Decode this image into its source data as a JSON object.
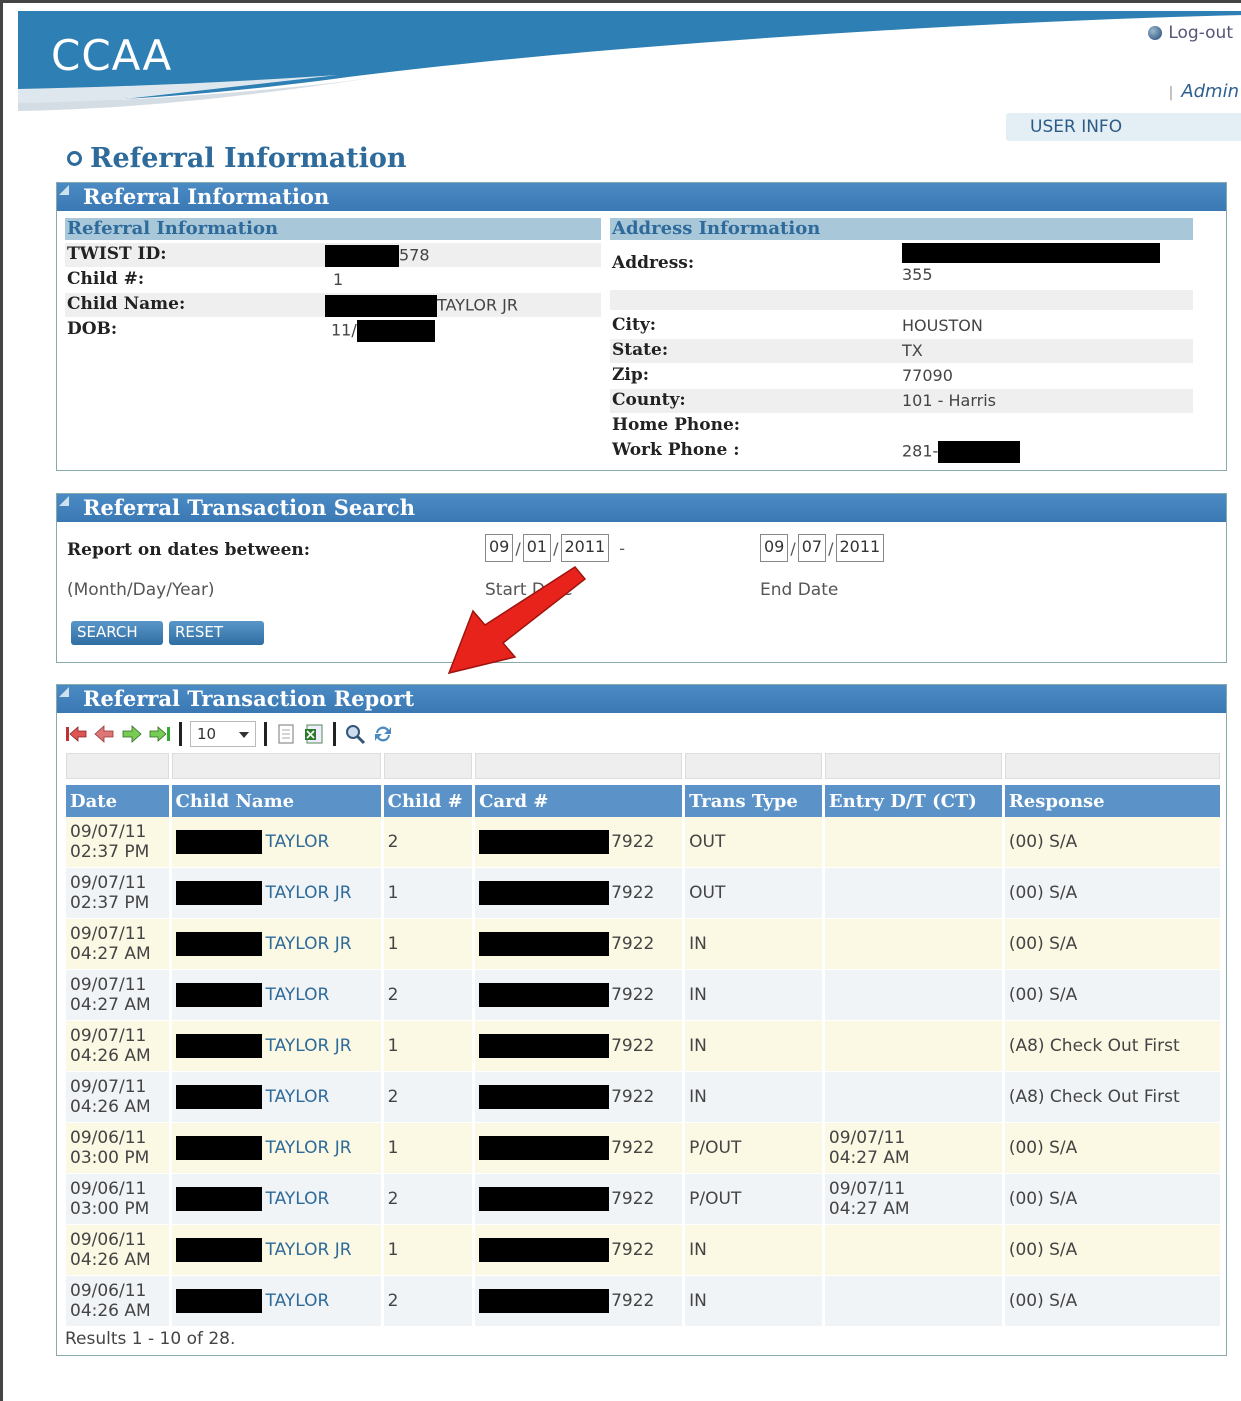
{
  "header": {
    "logo": "CCAA",
    "logout_label": "Log-out",
    "separator": "|",
    "user_name": "Admin",
    "user_info_tab": "USER INFO"
  },
  "page_title": "Referral Information",
  "referral_panel": {
    "title": "Referral Information",
    "left_section": {
      "heading": "Referral Information",
      "rows": [
        {
          "label": "TWIST ID:",
          "value": "578"
        },
        {
          "label": "Child #:",
          "value": "1"
        },
        {
          "label": "Child Name:",
          "value": "TAYLOR JR"
        },
        {
          "label": "DOB:",
          "value": "11/"
        }
      ]
    },
    "right_section": {
      "heading": "Address Information",
      "address_label": "Address:",
      "address_value": "355",
      "rows": [
        {
          "label": "City:",
          "value": "HOUSTON"
        },
        {
          "label": "State:",
          "value": "TX"
        },
        {
          "label": "Zip:",
          "value": "77090"
        },
        {
          "label": "County:",
          "value": "101 - Harris"
        },
        {
          "label": "Home Phone:",
          "value": ""
        },
        {
          "label": "Work Phone :",
          "value": "281-"
        }
      ]
    }
  },
  "search_panel": {
    "title": "Referral Transaction Search",
    "report_label": "Report on dates between:",
    "format_hint": "(Month/Day/Year)",
    "start": {
      "month": "09",
      "day": "01",
      "year": "2011",
      "caption": "Start Date"
    },
    "end": {
      "month": "09",
      "day": "07",
      "year": "2011",
      "caption": "End Date"
    },
    "dash": "-",
    "search_button": "SEARCH",
    "reset_button": "RESET"
  },
  "report_panel": {
    "title": "Referral Transaction Report",
    "page_size": "10",
    "columns": [
      "Date",
      "Child Name",
      "Child #",
      "Card #",
      "Trans Type",
      "Entry D/T (CT)",
      "Response"
    ],
    "rows": [
      {
        "date": "09/07/11",
        "time": "02:37 PM",
        "name": "TAYLOR",
        "child": "2",
        "card": "7922",
        "type": "OUT",
        "entry_date": "",
        "entry_time": "",
        "response": "(00) S/A"
      },
      {
        "date": "09/07/11",
        "time": "02:37 PM",
        "name": "TAYLOR JR",
        "child": "1",
        "card": "7922",
        "type": "OUT",
        "entry_date": "",
        "entry_time": "",
        "response": "(00) S/A"
      },
      {
        "date": "09/07/11",
        "time": "04:27 AM",
        "name": "TAYLOR JR",
        "child": "1",
        "card": "7922",
        "type": "IN",
        "entry_date": "",
        "entry_time": "",
        "response": "(00) S/A"
      },
      {
        "date": "09/07/11",
        "time": "04:27 AM",
        "name": "TAYLOR",
        "child": "2",
        "card": "7922",
        "type": "IN",
        "entry_date": "",
        "entry_time": "",
        "response": "(00) S/A"
      },
      {
        "date": "09/07/11",
        "time": "04:26 AM",
        "name": "TAYLOR JR",
        "child": "1",
        "card": "7922",
        "type": "IN",
        "entry_date": "",
        "entry_time": "",
        "response": "(A8) Check Out First"
      },
      {
        "date": "09/07/11",
        "time": "04:26 AM",
        "name": "TAYLOR",
        "child": "2",
        "card": "7922",
        "type": "IN",
        "entry_date": "",
        "entry_time": "",
        "response": "(A8) Check Out First"
      },
      {
        "date": "09/06/11",
        "time": "03:00 PM",
        "name": "TAYLOR JR",
        "child": "1",
        "card": "7922",
        "type": "P/OUT",
        "entry_date": "09/07/11",
        "entry_time": "04:27 AM",
        "response": "(00) S/A"
      },
      {
        "date": "09/06/11",
        "time": "03:00 PM",
        "name": "TAYLOR",
        "child": "2",
        "card": "7922",
        "type": "P/OUT",
        "entry_date": "09/07/11",
        "entry_time": "04:27 AM",
        "response": "(00) S/A"
      },
      {
        "date": "09/06/11",
        "time": "04:26 AM",
        "name": "TAYLOR JR",
        "child": "1",
        "card": "7922",
        "type": "IN",
        "entry_date": "",
        "entry_time": "",
        "response": "(00) S/A"
      },
      {
        "date": "09/06/11",
        "time": "04:26 AM",
        "name": "TAYLOR",
        "child": "2",
        "card": "7922",
        "type": "IN",
        "entry_date": "",
        "entry_time": "",
        "response": "(00) S/A"
      }
    ],
    "results_text": "Results 1 - 10 of 28."
  },
  "colors": {
    "brand_blue": "#2a7ab0",
    "panel_header": "#3a78b3",
    "annotation_arrow": "#e8231c"
  }
}
